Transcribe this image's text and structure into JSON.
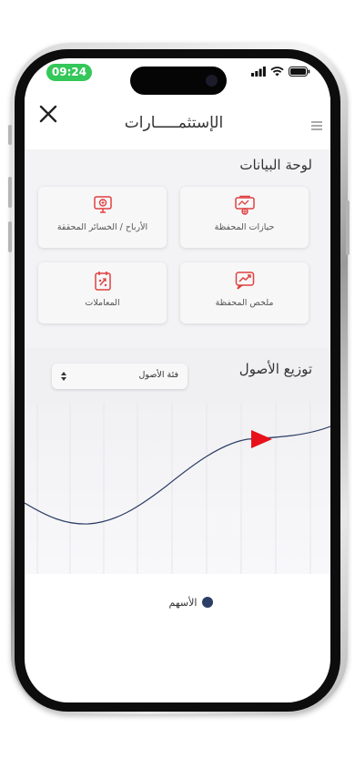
{
  "status_bar": {
    "time": "09:24"
  },
  "header": {
    "title": "الإستثمـــــارات"
  },
  "dashboard": {
    "title": "لوحة البيانات",
    "cards": [
      {
        "label": "حيازات المحفظة",
        "icon": "portfolio-holdings-icon"
      },
      {
        "label": "الأرباح / الخسائر المحققة",
        "icon": "realized-pnl-icon"
      },
      {
        "label": "ملخص المحفظة",
        "icon": "portfolio-summary-icon"
      },
      {
        "label": "المعاملات",
        "icon": "transactions-icon"
      }
    ]
  },
  "distribution": {
    "title": "توزيع الأصول",
    "select_value": "فئة الأصول"
  },
  "chart_data": {
    "type": "line",
    "series": [
      {
        "name": "الأسهم",
        "color": "#2d3e66"
      }
    ],
    "marker_color": "#e8101a",
    "grid": true
  },
  "colors": {
    "accent": "#e04040",
    "status_green": "#34c759",
    "series": "#2d3e66"
  }
}
